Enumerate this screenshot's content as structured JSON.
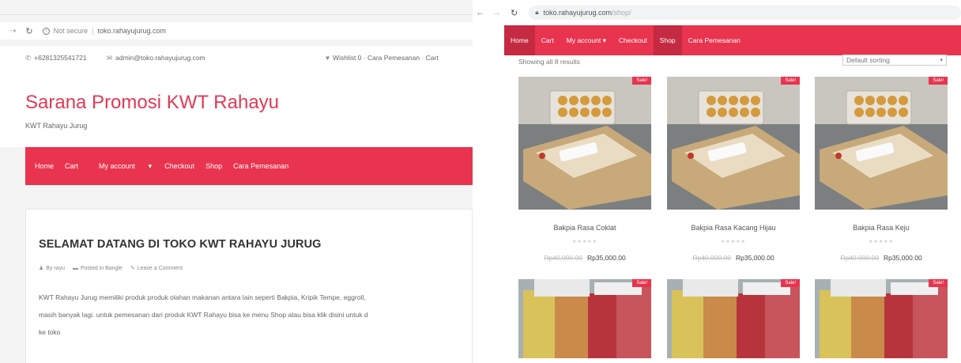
{
  "left_window": {
    "browser": {
      "security_label": "Not secure",
      "url": "toko.rahayujurug.com"
    },
    "topbar": {
      "phone": "+6281325541721",
      "email": "admin@toko.rahayujurug.com",
      "right_links": "Wishlist 0 · Cara Pemesanan · Cart"
    },
    "header": {
      "site_title": "Sarana Promosi KWT Rahayu",
      "site_description": "KWT Rahayu Jurug"
    },
    "nav": {
      "items": [
        "Home",
        "Cart",
        "My account",
        "Checkout",
        "Shop",
        "Cara Pemesanan"
      ]
    },
    "post": {
      "title": "SELAMAT DATANG DI TOKO KWT RAHAYU JURUG",
      "author": "By rayu",
      "category": "Posted in Bangle",
      "comment": "Leave a Comment",
      "body_lines": [
        "KWT Rahayu Jurug memiliki produk produk olahan makanan antara lain seperti Bakpia, Kripik Tempe, eggroll,",
        "masih banyak lagi. untuk pemesanan dari produk KWT Rahayu bisa ke menu Shop atau bisa klik disini untuk d",
        "ke toko"
      ]
    }
  },
  "right_window": {
    "browser": {
      "host": "toko.rahayujurug.com",
      "path": "/shop/"
    },
    "nav": {
      "items": [
        "Home",
        "Cart",
        "My account",
        "Checkout",
        "Shop",
        "Cara Pemesanan"
      ]
    },
    "shop": {
      "result_count": "Showing all 8 results",
      "sort_selected": "Default sorting",
      "sale_badge": "Sale!",
      "stars": "★★★★★",
      "products": [
        {
          "name": "Bakpia Rasa Coklat",
          "old_price": "Rp40,000.00",
          "price": "Rp35,000.00"
        },
        {
          "name": "Bakpia Rasa Kacang Hijau",
          "old_price": "Rp40,000.00",
          "price": "Rp35,000.00"
        },
        {
          "name": "Bakpia Rasa Keju",
          "old_price": "Rp40,000.00",
          "price": "Rp35,000.00"
        }
      ]
    }
  },
  "colors": {
    "brand": "#e8344f",
    "brand_dark": "#c42a41",
    "title": "#e23956"
  }
}
